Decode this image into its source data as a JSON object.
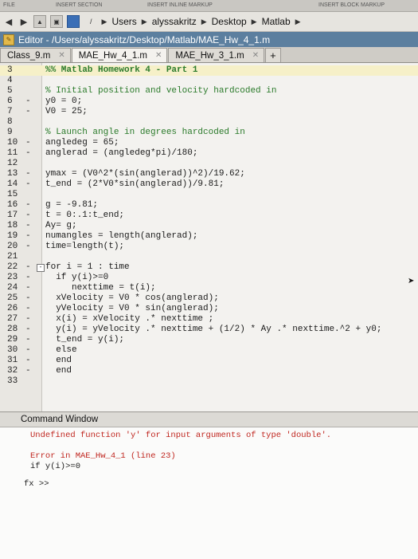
{
  "ribbon": {
    "labels": [
      "FILE",
      "INSERT SECTION",
      "INSERT INLINE MARKUP",
      "INSERT BLOCK MARKUP"
    ]
  },
  "path": {
    "crumbs": [
      "Users",
      "alyssakritz",
      "Desktop",
      "Matlab"
    ]
  },
  "editor": {
    "title": "Editor - /Users/alyssakritz/Desktop/Matlab/MAE_Hw_4_1.m",
    "tabs": [
      {
        "label": "Class_9.m",
        "active": false
      },
      {
        "label": "MAE_Hw_4_1.m",
        "active": true
      },
      {
        "label": "MAE_Hw_3_1.m",
        "active": false
      }
    ],
    "add_tab_label": "+",
    "lines": [
      {
        "n": "3",
        "dash": "",
        "text": "%% Matlab Homework 4 - Part 1",
        "kind": "cell"
      },
      {
        "n": "4",
        "dash": "",
        "text": "",
        "kind": "code"
      },
      {
        "n": "5",
        "dash": "",
        "text": "% Initial position and velocity hardcoded in",
        "kind": "cmt"
      },
      {
        "n": "6",
        "dash": "-",
        "text": "y0 = 0;",
        "kind": "code"
      },
      {
        "n": "7",
        "dash": "-",
        "text": "V0 = 25;",
        "kind": "code"
      },
      {
        "n": "8",
        "dash": "",
        "text": "",
        "kind": "code"
      },
      {
        "n": "9",
        "dash": "",
        "text": "% Launch angle in degrees hardcoded in",
        "kind": "cmt"
      },
      {
        "n": "10",
        "dash": "-",
        "text": "angledeg = 65;",
        "kind": "code"
      },
      {
        "n": "11",
        "dash": "-",
        "text": "anglerad = (angledeg*pi)/180;",
        "kind": "code"
      },
      {
        "n": "12",
        "dash": "",
        "text": "",
        "kind": "code"
      },
      {
        "n": "13",
        "dash": "-",
        "text": "ymax = (V0^2*(sin(anglerad))^2)/19.62;",
        "kind": "code"
      },
      {
        "n": "14",
        "dash": "-",
        "text": "t_end = (2*V0*sin(anglerad))/9.81;",
        "kind": "code"
      },
      {
        "n": "15",
        "dash": "",
        "text": "",
        "kind": "code"
      },
      {
        "n": "16",
        "dash": "-",
        "text": "g = -9.81;",
        "kind": "code"
      },
      {
        "n": "17",
        "dash": "-",
        "text": "t = 0:.1:t_end;",
        "kind": "code"
      },
      {
        "n": "18",
        "dash": "-",
        "text": "Ay= g;",
        "kind": "code"
      },
      {
        "n": "19",
        "dash": "-",
        "text": "numangles = length(anglerad);",
        "kind": "code"
      },
      {
        "n": "20",
        "dash": "-",
        "text": "time=length(t);",
        "kind": "code"
      },
      {
        "n": "21",
        "dash": "",
        "text": "",
        "kind": "code"
      },
      {
        "n": "22",
        "dash": "-",
        "text": "for i = 1 : time",
        "kind": "code",
        "fold": "-"
      },
      {
        "n": "23",
        "dash": "-",
        "text": "  if y(i)>=0",
        "kind": "code"
      },
      {
        "n": "24",
        "dash": "-",
        "text": "     nexttime = t(i);",
        "kind": "code"
      },
      {
        "n": "25",
        "dash": "-",
        "text": "  xVelocity = V0 * cos(anglerad);",
        "kind": "code"
      },
      {
        "n": "26",
        "dash": "-",
        "text": "  yVelocity = V0 * sin(anglerad);",
        "kind": "code"
      },
      {
        "n": "27",
        "dash": "-",
        "text": "  x(i) = xVelocity .* nexttime ;",
        "kind": "code"
      },
      {
        "n": "28",
        "dash": "-",
        "text": "  y(i) = yVelocity .* nexttime + (1/2) * Ay .* nexttime.^2 + y0;",
        "kind": "code"
      },
      {
        "n": "29",
        "dash": "-",
        "text": "  t_end = y(i);",
        "kind": "code"
      },
      {
        "n": "30",
        "dash": "-",
        "text": "  else",
        "kind": "code"
      },
      {
        "n": "31",
        "dash": "-",
        "text": "  end",
        "kind": "code"
      },
      {
        "n": "32",
        "dash": "-",
        "text": "  end",
        "kind": "code"
      },
      {
        "n": "33",
        "dash": "",
        "text": "",
        "kind": "code"
      }
    ]
  },
  "command_window": {
    "title": "Command Window",
    "lines": [
      {
        "text": "Undefined function 'y' for input arguments of type 'double'.",
        "kind": "err"
      },
      {
        "text": "",
        "kind": "plain"
      },
      {
        "text": "Error in MAE_Hw_4_1 (line 23)",
        "kind": "err"
      },
      {
        "text": "if y(i)>=0",
        "kind": "plain"
      }
    ],
    "prompt": "fx >>"
  }
}
